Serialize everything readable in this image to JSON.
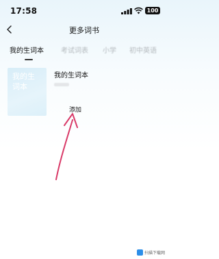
{
  "status_bar": {
    "time": "17:58",
    "battery": "100",
    "icons": [
      "signal-icon",
      "wifi-icon",
      "battery-icon"
    ]
  },
  "nav": {
    "title": "更多词书",
    "back_icon": "chevron-left-icon"
  },
  "tabs": [
    {
      "label": "我的生词本",
      "active": true
    },
    {
      "label": "考试词表",
      "active": false
    },
    {
      "label": "小学",
      "active": false
    },
    {
      "label": "初中英语",
      "active": false
    }
  ],
  "book": {
    "cover_title": "我的生词本",
    "title": "我的生词本"
  },
  "add_label": "添加",
  "annotation": {
    "arrow_color": "#d93a68"
  },
  "watermark": {
    "text": "扫描下载网"
  }
}
